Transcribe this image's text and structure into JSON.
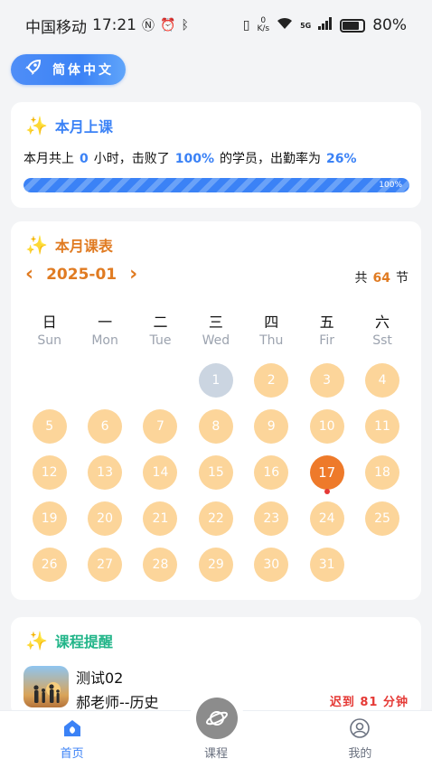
{
  "status_bar": {
    "carrier": "中国移动",
    "time": "17:21",
    "speed_value": "0",
    "speed_unit": "K/s",
    "network": "5G",
    "battery": "80%"
  },
  "language_button": {
    "label": "简体中文"
  },
  "month_class": {
    "title": "本月上课",
    "text_prefix": "本月共上",
    "hours": "0",
    "text_mid1": "小时，击败了",
    "beat_percent": "100%",
    "text_mid2": "的学员，出勤率为",
    "attendance": "26%",
    "progress_label": "100%",
    "progress_value": 1.0
  },
  "schedule": {
    "title": "本月课表",
    "prev_arrow": "‹",
    "month": "2025-01",
    "next_arrow": "›",
    "total_prefix": "共",
    "total_count": "64",
    "total_suffix": "节",
    "weekdays": [
      {
        "cn": "日",
        "en": "Sun"
      },
      {
        "cn": "一",
        "en": "Mon"
      },
      {
        "cn": "二",
        "en": "Tue"
      },
      {
        "cn": "三",
        "en": "Wed"
      },
      {
        "cn": "四",
        "en": "Thu"
      },
      {
        "cn": "五",
        "en": "Fir"
      },
      {
        "cn": "六",
        "en": "Sst"
      }
    ],
    "first_weekday_index": 3,
    "days_in_month": 31,
    "past_days": [
      1
    ],
    "today": 17,
    "marked_days": [
      17
    ]
  },
  "reminder": {
    "title": "课程提醒",
    "course_name": "测试02",
    "teacher": "郝老师--历史",
    "status": "迟到 81 分钟"
  },
  "tabbar": {
    "home": "首页",
    "course": "课程",
    "mine": "我的"
  },
  "colors": {
    "blue": "#3b82f6",
    "orange": "#e07b22",
    "green": "#22b589",
    "day_bg": "#fcd59a",
    "today_bg": "#ee7a2a",
    "past_bg": "#cbd5e1"
  }
}
